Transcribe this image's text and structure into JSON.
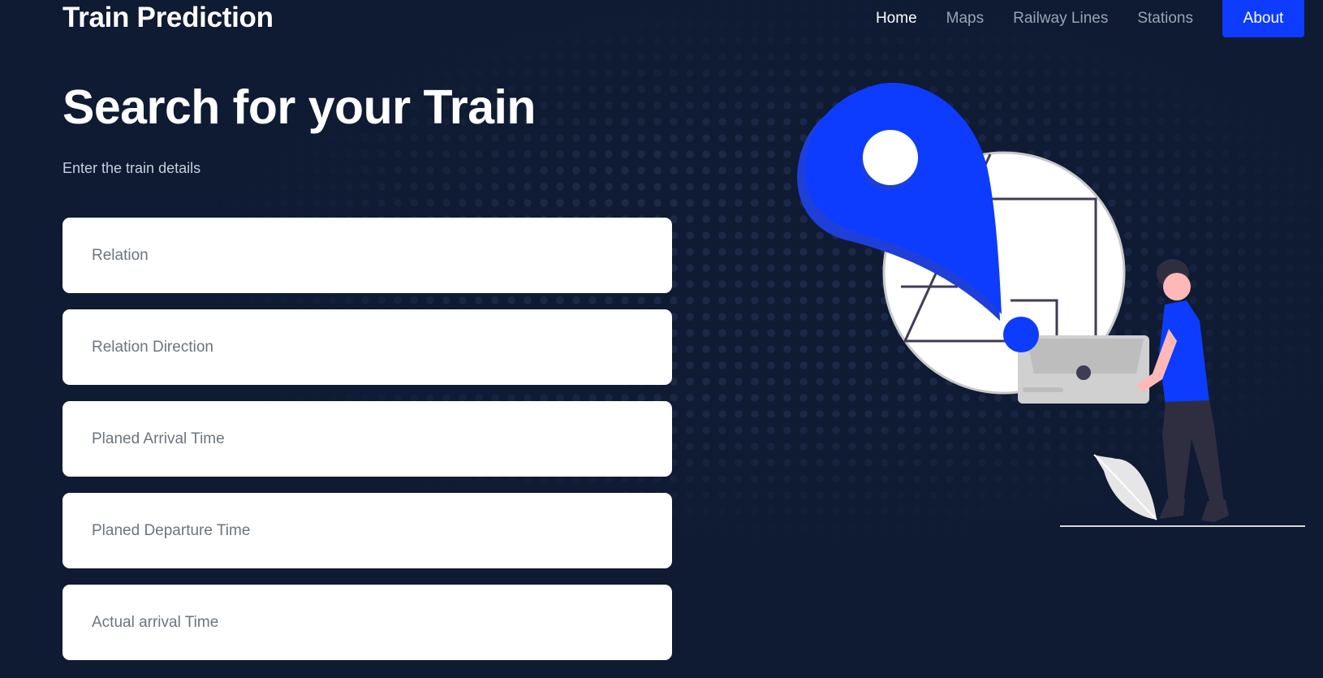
{
  "header": {
    "brand": "Train Prediction",
    "nav": [
      "Home",
      "Maps",
      "Railway Lines",
      "Stations"
    ],
    "about": "About"
  },
  "hero": {
    "title": "Search for your Train",
    "subtitle": "Enter the train details"
  },
  "form": {
    "relation_placeholder": "Relation",
    "relation_direction_placeholder": "Relation Direction",
    "planned_arrival_placeholder": "Planed Arrival Time",
    "planned_departure_placeholder": "Planed Departure Time",
    "actual_arrival_placeholder": "Actual arrival Time"
  },
  "colors": {
    "background": "#0f1a33",
    "accent": "#0d3cfe"
  },
  "illustration": {
    "icon": "map-pin-person-illustration"
  }
}
